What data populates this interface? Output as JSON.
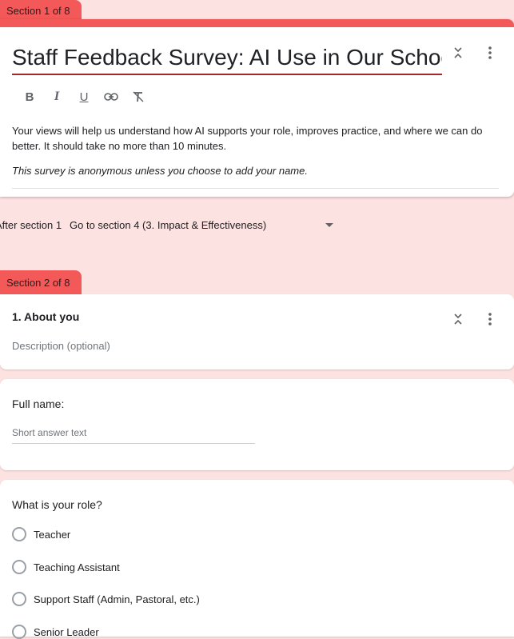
{
  "section1": {
    "tab_label": "Section 1 of 8",
    "title": "Staff Feedback Survey: AI Use in Our School",
    "description_p1": "Your views will help us understand how AI supports your role, improves practice, and where we can do better. It should take no more than 10 minutes.",
    "description_p2": "This survey is anonymous unless you choose to add your name.",
    "toolbar": [
      {
        "icon": "bold-icon",
        "glyph": "B"
      },
      {
        "icon": "italic-icon",
        "glyph": "I"
      },
      {
        "icon": "underline-icon",
        "glyph": "U"
      },
      {
        "icon": "link-icon",
        "glyph": "🔗"
      },
      {
        "icon": "clear-format-icon",
        "glyph": "T"
      }
    ]
  },
  "after_section": {
    "label": "After section 1",
    "selected": "Go to section 4 (3. Impact & Effectiveness)"
  },
  "section2": {
    "tab_label": "Section 2 of 8",
    "title": "1. About you",
    "description_placeholder": "Description (optional)"
  },
  "question_name": {
    "label": "Full name:",
    "placeholder": "Short answer text"
  },
  "question_role": {
    "label": "What is your role?",
    "options": [
      "Teacher",
      "Teaching Assistant",
      "Support Staff (Admin, Pastoral, etc.)",
      "Senior Leader"
    ]
  },
  "colors": {
    "accent": "#f35959",
    "background": "#fde2e2",
    "title_underline": "#9e2a2a"
  }
}
